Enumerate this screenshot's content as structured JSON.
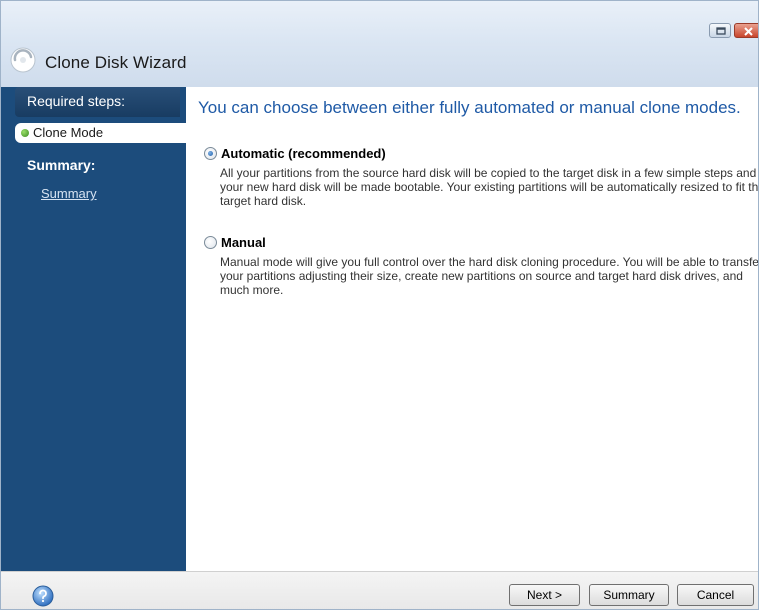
{
  "window": {
    "title": "Clone Disk Wizard"
  },
  "sidebar": {
    "required_heading": "Required steps:",
    "active_step": "Clone Mode",
    "summary_heading": "Summary:",
    "summary_link": "Summary"
  },
  "main": {
    "headline": "You can choose between either fully automated or manual clone modes.",
    "options": [
      {
        "label": "Automatic (recommended)",
        "selected": true,
        "description": "All your partitions from the source hard disk will be copied to the target disk in a few simple steps and your new hard disk will be made bootable. Your existing partitions will be automatically resized to fit the target hard disk."
      },
      {
        "label": "Manual",
        "selected": false,
        "description": "Manual mode will give you full control over the hard disk cloning procedure. You will be able to transfer your partitions adjusting their size, create new partitions on source and target hard disk drives, and much more."
      }
    ]
  },
  "footer": {
    "next_label": "Next >",
    "summary_label": "Summary",
    "cancel_label": "Cancel"
  },
  "icons": {
    "app": "app-logo-icon",
    "restore": "restore-icon",
    "close": "close-icon",
    "step_bullet": "green-bullet-icon",
    "help": "help-icon"
  },
  "colors": {
    "sidebar": "#1c4c7c",
    "headline": "#1f5aa6",
    "active_bullet": "#3c8a22"
  }
}
